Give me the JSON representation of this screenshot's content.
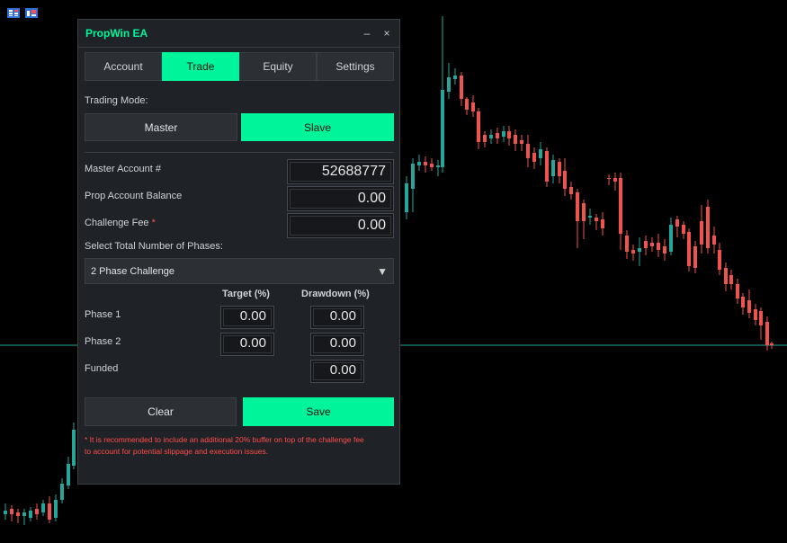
{
  "panel": {
    "title": "PropWin EA",
    "minimize": "–",
    "close": "×"
  },
  "tabs": [
    {
      "label": "Account"
    },
    {
      "label": "Trade"
    },
    {
      "label": "Equity"
    },
    {
      "label": "Settings"
    }
  ],
  "active_tab": "Trade",
  "trading_mode": {
    "label": "Trading Mode:",
    "master": "Master",
    "slave": "Slave",
    "selected": "Slave"
  },
  "fields": {
    "master_account": {
      "label": "Master Account #",
      "value": "52688777"
    },
    "prop_balance": {
      "label": "Prop Account Balance",
      "value": "0.00"
    },
    "challenge_fee": {
      "label": "Challenge Fee",
      "required_mark": "*",
      "value": "0.00"
    }
  },
  "phases": {
    "label": "Select Total Number of Phases:",
    "selected": "2 Phase Challenge",
    "caret": "▼",
    "target_header": "Target (%)",
    "drawdown_header": "Drawdown (%)",
    "rows": [
      {
        "name": "Phase 1",
        "target": "0.00",
        "drawdown": "0.00"
      },
      {
        "name": "Phase 2",
        "target": "0.00",
        "drawdown": "0.00"
      },
      {
        "name": "Funded",
        "drawdown": "0.00"
      }
    ]
  },
  "buttons": {
    "clear": "Clear",
    "save": "Save"
  },
  "note": {
    "line1": "* It is recommended to include an additional 20% buffer on top of the challenge fee",
    "line2": "to account for potential slippage and execution issues."
  },
  "colors": {
    "accent": "#00f59b",
    "bull": "#26a69a",
    "bear": "#ef5350",
    "background": "#000000",
    "panel": "#1f2226"
  }
}
